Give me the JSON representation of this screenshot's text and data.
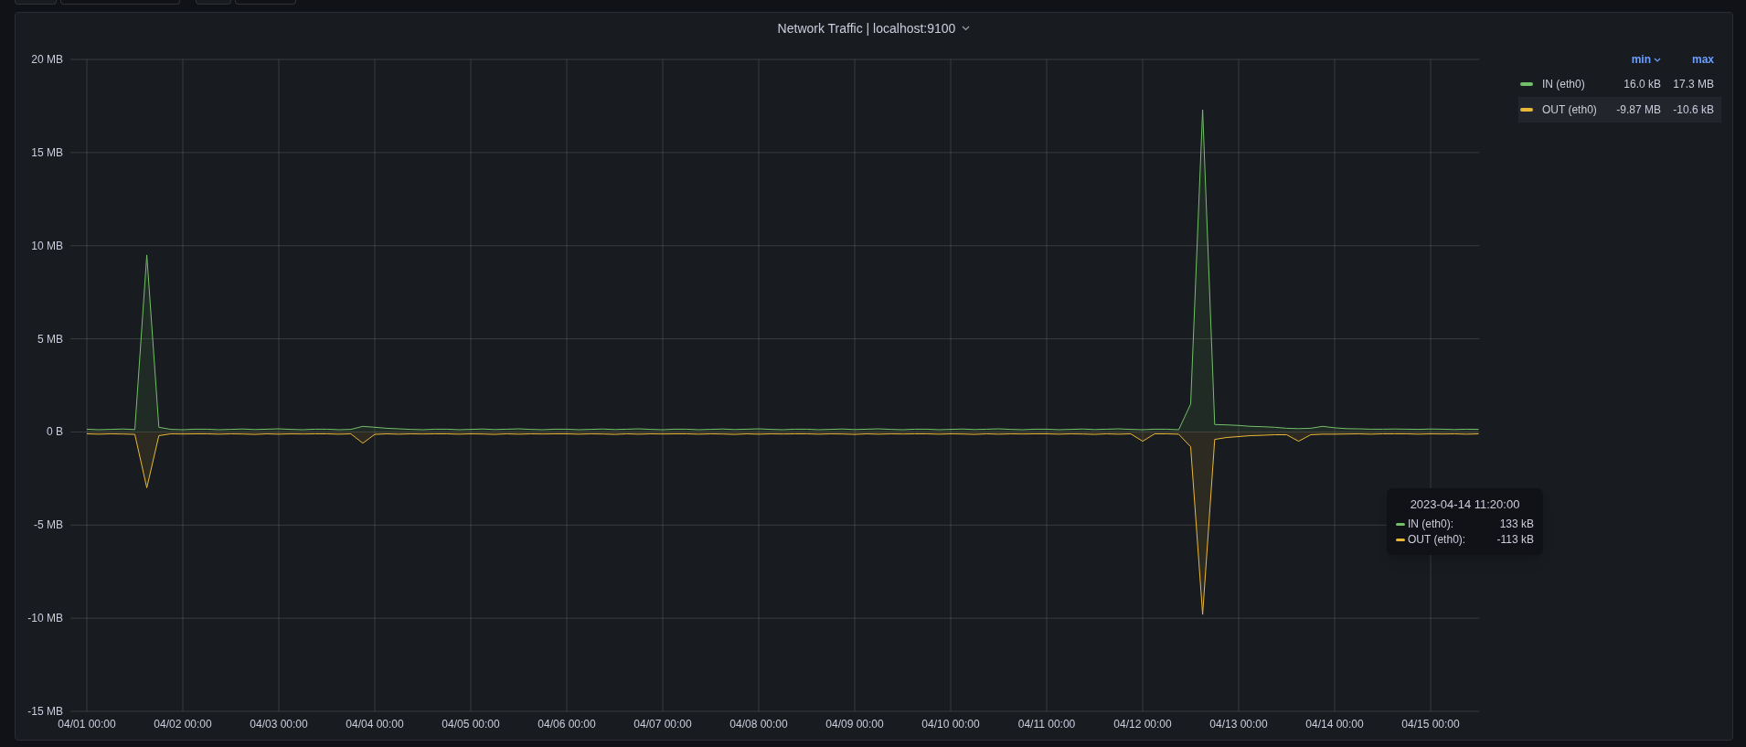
{
  "panel": {
    "title": "Network Traffic | localhost:9100",
    "chart_data": {
      "type": "area",
      "grid": true,
      "ylim": [
        -15,
        20
      ],
      "categories": [
        "04/01 00:00",
        null,
        null,
        null,
        null,
        null,
        null,
        null,
        "04/02 00:00",
        null,
        null,
        null,
        null,
        null,
        null,
        null,
        "04/03 00:00",
        null,
        null,
        null,
        null,
        null,
        null,
        null,
        "04/04 00:00",
        null,
        null,
        null,
        null,
        null,
        null,
        null,
        "04/05 00:00",
        null,
        null,
        null,
        null,
        null,
        null,
        null,
        "04/06 00:00",
        null,
        null,
        null,
        null,
        null,
        null,
        null,
        "04/07 00:00",
        null,
        null,
        null,
        null,
        null,
        null,
        null,
        "04/08 00:00",
        null,
        null,
        null,
        null,
        null,
        null,
        null,
        "04/09 00:00",
        null,
        null,
        null,
        null,
        null,
        null,
        null,
        "04/10 00:00",
        null,
        null,
        null,
        null,
        null,
        null,
        null,
        "04/11 00:00",
        null,
        null,
        null,
        null,
        null,
        null,
        null,
        "04/12 00:00",
        null,
        null,
        null,
        null,
        null,
        null,
        null,
        "04/13 00:00",
        null,
        null,
        null,
        null,
        null,
        null,
        null,
        "04/14 00:00",
        null,
        null,
        null,
        null,
        null,
        null,
        null,
        "04/15 00:00",
        null,
        null,
        null,
        null
      ],
      "series": [
        {
          "name": "IN (eth0)",
          "color": "#73bf69",
          "values": [
            0.15,
            0.12,
            0.14,
            0.16,
            0.13,
            9.5,
            0.25,
            0.14,
            0.12,
            0.15,
            0.15,
            0.12,
            0.14,
            0.16,
            0.13,
            0.15,
            0.17,
            0.14,
            0.12,
            0.15,
            0.15,
            0.12,
            0.14,
            0.3,
            0.25,
            0.2,
            0.17,
            0.14,
            0.12,
            0.15,
            0.15,
            0.12,
            0.14,
            0.16,
            0.13,
            0.15,
            0.17,
            0.14,
            0.12,
            0.15,
            0.15,
            0.12,
            0.14,
            0.16,
            0.13,
            0.15,
            0.17,
            0.14,
            0.12,
            0.15,
            0.15,
            0.12,
            0.14,
            0.16,
            0.13,
            0.15,
            0.17,
            0.14,
            0.12,
            0.15,
            0.15,
            0.12,
            0.14,
            0.16,
            0.13,
            0.15,
            0.17,
            0.14,
            0.12,
            0.15,
            0.15,
            0.12,
            0.14,
            0.16,
            0.13,
            0.15,
            0.17,
            0.14,
            0.12,
            0.15,
            0.15,
            0.12,
            0.14,
            0.16,
            0.13,
            0.15,
            0.17,
            0.14,
            0.12,
            0.15,
            0.15,
            0.12,
            1.5,
            17.3,
            0.4,
            0.38,
            0.35,
            0.3,
            0.28,
            0.25,
            0.2,
            0.18,
            0.2,
            0.3,
            0.22,
            0.18,
            0.17,
            0.15,
            0.15,
            0.16,
            0.15,
            0.14,
            0.16,
            0.15,
            0.13,
            0.15,
            0.14
          ]
        },
        {
          "name": "OUT (eth0)",
          "color": "#eab839",
          "values": [
            -0.1,
            -0.12,
            -0.1,
            -0.11,
            -0.13,
            -3.0,
            -0.2,
            -0.1,
            -0.11,
            -0.1,
            -0.1,
            -0.12,
            -0.1,
            -0.11,
            -0.13,
            -0.1,
            -0.12,
            -0.1,
            -0.11,
            -0.1,
            -0.1,
            -0.12,
            -0.1,
            -0.6,
            -0.13,
            -0.1,
            -0.12,
            -0.1,
            -0.11,
            -0.1,
            -0.1,
            -0.12,
            -0.1,
            -0.11,
            -0.13,
            -0.1,
            -0.12,
            -0.1,
            -0.11,
            -0.1,
            -0.1,
            -0.12,
            -0.1,
            -0.11,
            -0.13,
            -0.1,
            -0.12,
            -0.1,
            -0.11,
            -0.1,
            -0.1,
            -0.12,
            -0.1,
            -0.11,
            -0.13,
            -0.1,
            -0.12,
            -0.1,
            -0.11,
            -0.1,
            -0.1,
            -0.12,
            -0.1,
            -0.11,
            -0.13,
            -0.1,
            -0.12,
            -0.1,
            -0.11,
            -0.1,
            -0.1,
            -0.12,
            -0.1,
            -0.11,
            -0.13,
            -0.1,
            -0.12,
            -0.1,
            -0.11,
            -0.1,
            -0.1,
            -0.12,
            -0.1,
            -0.11,
            -0.13,
            -0.1,
            -0.12,
            -0.1,
            -0.5,
            -0.1,
            -0.1,
            -0.12,
            -0.8,
            -9.8,
            -0.4,
            -0.3,
            -0.25,
            -0.2,
            -0.18,
            -0.15,
            -0.15,
            -0.5,
            -0.15,
            -0.12,
            -0.12,
            -0.11,
            -0.1,
            -0.12,
            -0.1,
            -0.1,
            -0.1,
            -0.12,
            -0.1,
            -0.11,
            -0.1,
            -0.12,
            -0.1
          ]
        }
      ],
      "yticks": [
        {
          "value": -15,
          "label": "-15 MB"
        },
        {
          "value": -10,
          "label": "-10 MB"
        },
        {
          "value": -5,
          "label": "-5 MB"
        },
        {
          "value": 0,
          "label": "0 B"
        },
        {
          "value": 5,
          "label": "5 MB"
        },
        {
          "value": 10,
          "label": "10 MB"
        },
        {
          "value": 15,
          "label": "15 MB"
        },
        {
          "value": 20,
          "label": "20 MB"
        }
      ]
    },
    "legend": {
      "columns": [
        {
          "label": "min",
          "sorted": true
        },
        {
          "label": "max",
          "sorted": false
        }
      ],
      "items": [
        {
          "min": "16.0 kB",
          "max": "17.3 MB",
          "highlighted": false
        },
        {
          "min": "-9.87 MB",
          "max": "-10.6 kB",
          "highlighted": true
        }
      ]
    },
    "tooltip": {
      "time": "2023-04-14 11:20:00",
      "rows": [
        {
          "name": "IN (eth0):",
          "color": "#73bf69",
          "value": "133 kB"
        },
        {
          "name": "OUT (eth0):",
          "color": "#eab839",
          "value": "-113 kB"
        }
      ]
    }
  }
}
